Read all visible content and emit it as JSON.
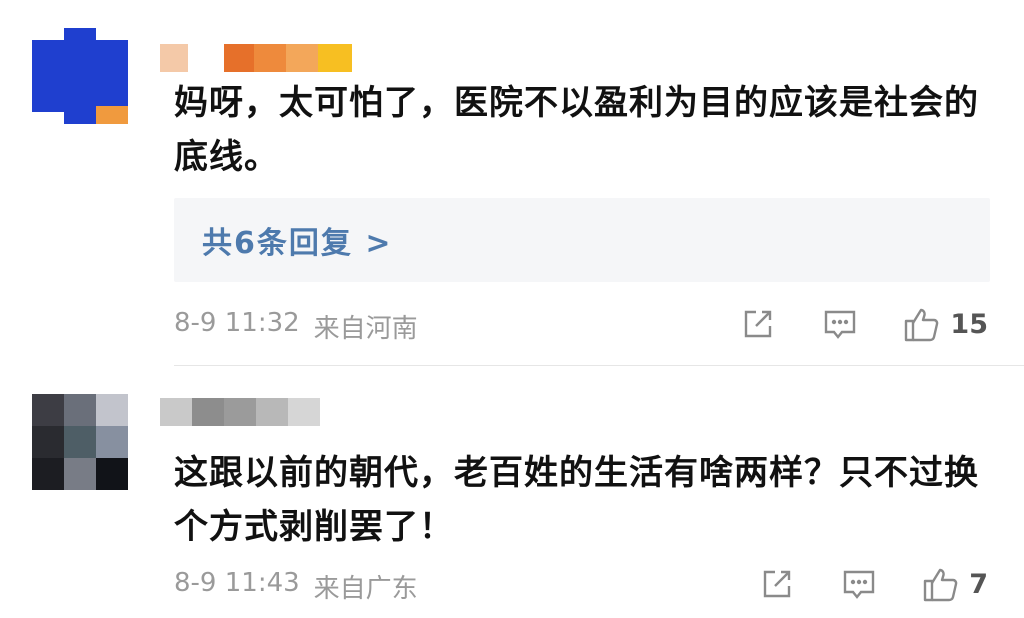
{
  "comments": [
    {
      "text": "妈呀，太可怕了，医院不以盈利为目的应该是社会的底线。",
      "replies_label": "共6条回复 >",
      "date": "8-9 11:32",
      "location": "来自河南",
      "likes": "15",
      "icons": [
        "share-icon",
        "comment-icon",
        "thumbs-up-icon"
      ]
    },
    {
      "text": "这跟以前的朝代，老百姓的生活有啥两样？只不过换个方式剥削罢了！",
      "date": "8-9 11:43",
      "location": "来自广东",
      "likes": "7",
      "icons": [
        "share-icon",
        "comment-icon",
        "thumbs-up-icon"
      ]
    }
  ],
  "colors": {
    "link": "#4e7aad",
    "meta": "#9a9a9a",
    "avatar1": "#1f3fcf",
    "avatar1_accent": "#f09a3e"
  }
}
